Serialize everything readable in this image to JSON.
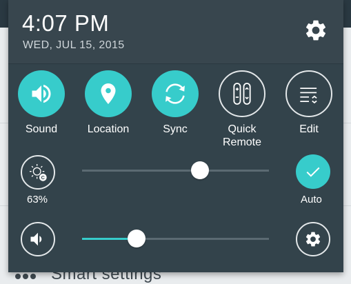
{
  "status": {
    "time": "4:07 PM",
    "date": "WED, JUL 15, 2015"
  },
  "quick_settings": [
    {
      "label": "Sound",
      "icon": "speaker-icon",
      "enabled": true
    },
    {
      "label": "Location",
      "icon": "location-pin-icon",
      "enabled": true
    },
    {
      "label": "Sync",
      "icon": "sync-icon",
      "enabled": true
    },
    {
      "label": "Quick Remote",
      "icon": "remote-icon",
      "enabled": false
    },
    {
      "label": "Edit",
      "icon": "edit-list-icon",
      "enabled": false
    }
  ],
  "brightness": {
    "percent_label": "63%",
    "level": 0.63,
    "auto_label": "Auto",
    "auto_enabled": true
  },
  "volume": {
    "level": 0.29
  },
  "background": {
    "partial_text": "Smart settings"
  },
  "colors": {
    "accent": "#37cccb",
    "panel": "#33434b",
    "header": "#38464e"
  }
}
